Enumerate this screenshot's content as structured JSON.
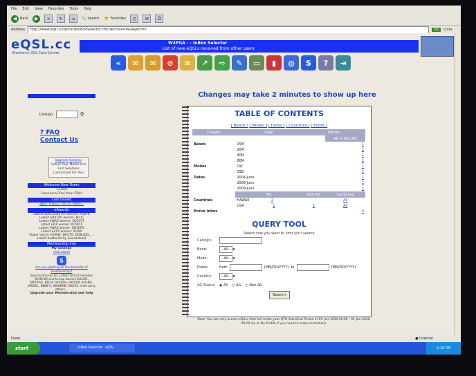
{
  "menu": [
    "File",
    "Edit",
    "View",
    "Favorites",
    "Tools",
    "Help"
  ],
  "toolbar": {
    "back": "Back",
    "search": "Search",
    "favorites": "Favorites"
  },
  "address": {
    "label": "Address",
    "url": "http://www.eqsl.cc/qslcard/InboxSelector.cfm?Archive=0&Reject=0",
    "go": "Go",
    "links": "Links"
  },
  "header": {
    "logo": "eQSL.cc",
    "logo_sub": "Electronic QSL Card Centre",
    "title": "W3PGA - - InBox Selector",
    "subtitle": "List of new eQSLs received from other users"
  },
  "sidebar": {
    "callsign_label": "Callsign:",
    "faq": "FAQ",
    "contact": "Contact Us",
    "upgrade_title": "Upgrade Selector",
    "upgrade_text": "Select Your Model and Find Solutions Customized For You!",
    "welcome_head": "Welcome New Users",
    "welcome_count": "13,004",
    "welcome_from": "Francesco D'Ari from ITALY",
    "last_head": "Last Issued",
    "last_text": "34th: YU1EZ, YU1TT, more...",
    "awards_head": "eAwards",
    "awards_lines": [
      "Latest eQSL Gold Pin winner: AA8YK",
      "Latest eDX100 winner: IK1IC",
      "Latest eWAZ winner: DL6YYT",
      "Latest eDX winner: KC5KTF",
      "Latest eWAS winner: KB1EFD",
      "Latest eZ45 winner: KI2WI",
      "Power Users: K3WW, DK5TX, DO6UDD, ...",
      "Latest Authenticity Guaranteed"
    ],
    "membership_head": "Membership Info",
    "savings": "My Savings",
    "calculate": "(calculate)",
    "benefits": "Are you getting all the benefits of membership?",
    "thanks": "Special thanks to: Latest GOLD member OH4CWI and to top donors K2LZG, SM7BYQ, BD1A, W4BSH, HK3YJR, K1HBL, W9SSL, BD8FX, WA8B0B, DK1W, and many others...",
    "upgrade_cta": "Upgrade your Membership and help"
  },
  "main": {
    "notice": "Changes may take 2 minutes to show up here",
    "toc_title": "TABLE OF CONTENTS",
    "toc_links": [
      "[ Bands ]",
      "[ Modes ]",
      "[ Dates ]",
      "[ Countries ]",
      "[ Entire ]"
    ],
    "toc_headers": {
      "chapter": "Chapter",
      "page": "Page",
      "entries": "Entries",
      "ag": "AG + Non-AG"
    },
    "bands": {
      "label": "Bands",
      "rows": [
        [
          "15M",
          "1"
        ],
        [
          "20M",
          "1"
        ],
        [
          "40M",
          "1"
        ],
        [
          "80M",
          "1"
        ]
      ]
    },
    "modes": {
      "label": "Modes",
      "rows": [
        [
          "CW",
          "1"
        ],
        [
          "SSB",
          "1"
        ]
      ]
    },
    "dates": {
      "label": "Dates",
      "rows": [
        [
          "2004 June",
          "1"
        ],
        [
          "2008 June",
          "1"
        ],
        [
          "2009 June",
          "1"
        ]
      ]
    },
    "countries_headers": {
      "ag": "AG",
      "nonag": "Non-AG",
      "combined": "Combined"
    },
    "countries": {
      "label": "Countries",
      "rows": [
        [
          "HAWAII",
          "2",
          "",
          "All"
        ],
        [
          "USA",
          "1",
          "2",
          "All"
        ]
      ]
    },
    "entire": {
      "label": "Entire Inbox",
      "value": "3"
    },
    "qt_title": "QUERY TOOL",
    "qt_hint": "Select how you want to limit your search",
    "fields": {
      "callsign": "Callsign:",
      "band": "Band:",
      "mode": "Mode:",
      "dates": "Dates:",
      "from": "from",
      "fmt": "(MM/DD/YYYY)",
      "to": "to",
      "country": "Country:",
      "ag_status": "AG Status:",
      "all_opt": "--All--",
      "radio_all": "All",
      "radio_ag": "AG",
      "radio_nonag": "Non-AG"
    },
    "search_btn": "Search",
    "note": "Note: You can only access eQSLs that fall inside your QTH Start/End Period of 01-Jan-1930 00:00 - 01-Jan-2020 00:00 Go to My Profile if you need to make corrections"
  },
  "status": {
    "left": "Done",
    "right": "Internet"
  },
  "taskbar": {
    "start": "start",
    "item": "InBox Selector - eQS...",
    "clock": "2:16 PM"
  }
}
